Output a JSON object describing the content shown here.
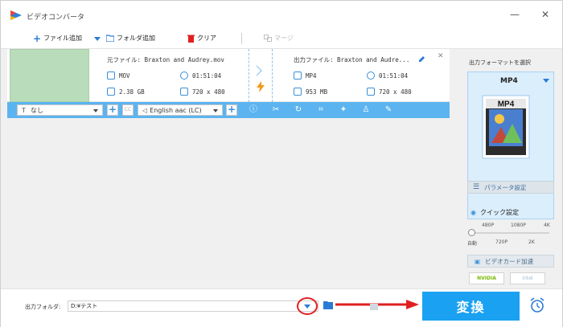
{
  "window": {
    "title": "ビデオコンバータ",
    "minimize": "—",
    "close": "✕"
  },
  "toolbar": {
    "add_file": "ファイル追加",
    "add_folder": "フォルダ追加",
    "clear": "クリア",
    "merge": "マージ"
  },
  "file": {
    "source_label": "元ファイル: Braxton and Audrey.mov",
    "output_label": "出力ファイル: Braxton and Audre...",
    "source": {
      "format": "MOV",
      "duration": "01:51:04",
      "size": "2.38 GB",
      "resolution": "720 x 480"
    },
    "output": {
      "format": "MP4",
      "duration": "01:51:04",
      "size": "953 MB",
      "resolution": "720 x 480"
    },
    "close": "✕"
  },
  "editbar": {
    "subtitle": "なし",
    "audio": "English aac (LC)",
    "add": "+",
    "cc": "CC"
  },
  "right": {
    "select_format_label": "出力フォーマットを選択",
    "format_name": "MP4",
    "format_icon_text": "MP4",
    "params_button": "パラメータ設定",
    "quick_settings": "クイック設定",
    "scale_top": [
      "480P",
      "1080P",
      "4K"
    ],
    "scale_bottom": [
      "自動",
      "720P",
      "2K"
    ],
    "gpu_accel": "ビデオカード加速",
    "gpu_vendors": [
      "NVIDIA",
      "intel"
    ]
  },
  "bottom": {
    "output_folder_label": "出力フォルダ:",
    "output_folder_value": "D:¥テスト",
    "convert_button": "変換"
  },
  "colors": {
    "accent": "#1aa1f2",
    "editbar": "#5bb4f0",
    "thumbnail": "#b9dcbb",
    "annotation_red": "#e02020",
    "format_card": "#dbeefc"
  }
}
